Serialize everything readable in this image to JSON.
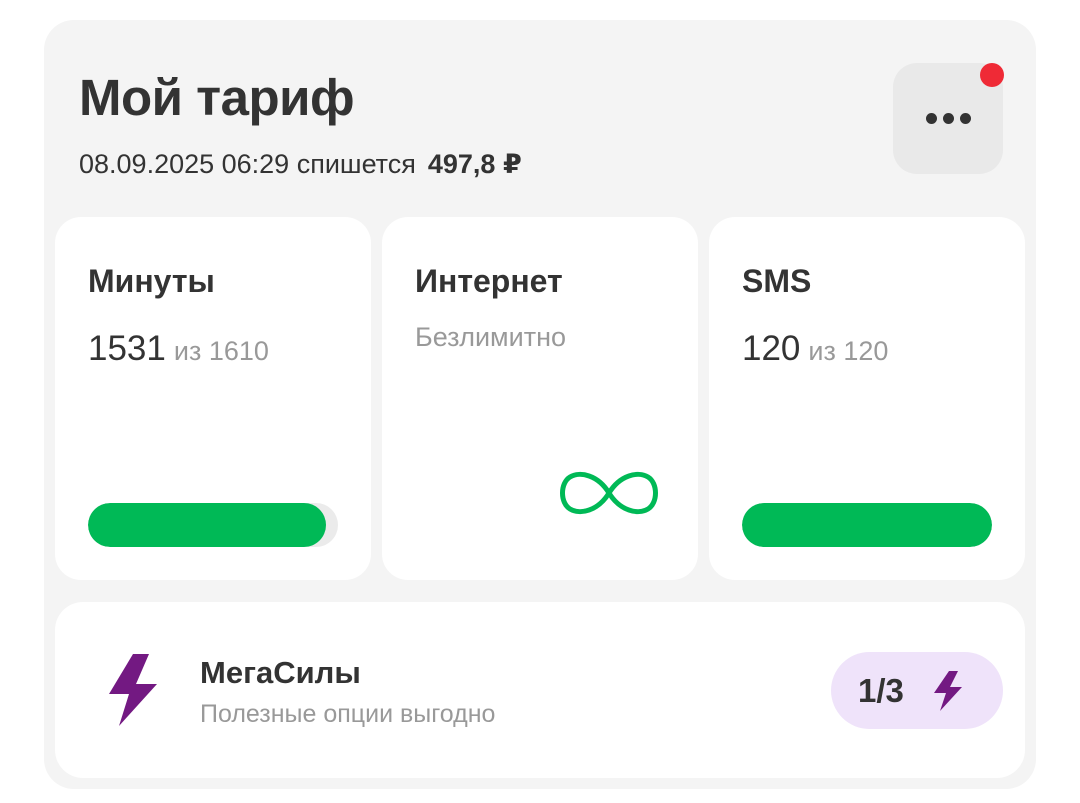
{
  "header": {
    "title": "Мой тариф",
    "charge_text": "08.09.2025 06:29 спишется",
    "charge_amount": "497,8 ₽"
  },
  "tiles": {
    "minutes": {
      "title": "Минуты",
      "remaining": "1531",
      "of_total": "из 1610",
      "progress": 0.95
    },
    "internet": {
      "title": "Интернет",
      "status": "Безлимитно",
      "icon": "infinity-icon"
    },
    "sms": {
      "title": "SMS",
      "remaining": "120",
      "of_total": "из 120",
      "progress": 1.0
    }
  },
  "megasily": {
    "title": "МегаСилы",
    "subtitle": "Полезные опции выгодно",
    "counter": "1/3",
    "icon": "lightning-icon"
  },
  "colors": {
    "accent_green": "#00b956",
    "accent_purple": "#731982",
    "notification_red": "#ef2a36",
    "badge_bg": "#efe3fa"
  }
}
